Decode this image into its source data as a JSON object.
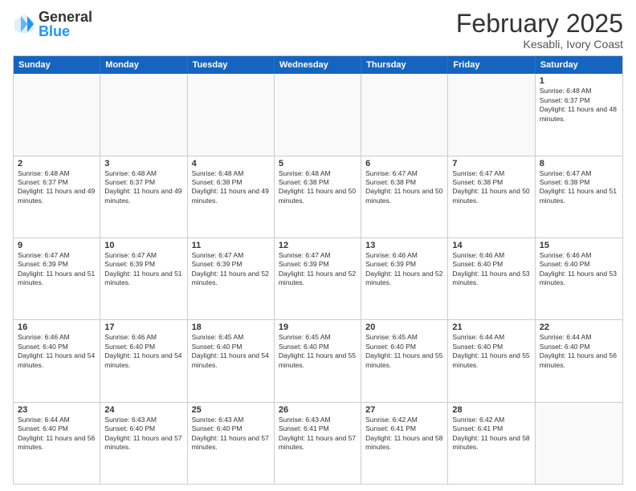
{
  "logo": {
    "general": "General",
    "blue": "Blue"
  },
  "title": {
    "month": "February 2025",
    "location": "Kesabli, Ivory Coast"
  },
  "header": {
    "days": [
      "Sunday",
      "Monday",
      "Tuesday",
      "Wednesday",
      "Thursday",
      "Friday",
      "Saturday"
    ]
  },
  "weeks": [
    [
      {
        "day": "",
        "text": ""
      },
      {
        "day": "",
        "text": ""
      },
      {
        "day": "",
        "text": ""
      },
      {
        "day": "",
        "text": ""
      },
      {
        "day": "",
        "text": ""
      },
      {
        "day": "",
        "text": ""
      },
      {
        "day": "1",
        "text": "Sunrise: 6:48 AM\nSunset: 6:37 PM\nDaylight: 11 hours and 48 minutes."
      }
    ],
    [
      {
        "day": "2",
        "text": "Sunrise: 6:48 AM\nSunset: 6:37 PM\nDaylight: 11 hours and 49 minutes."
      },
      {
        "day": "3",
        "text": "Sunrise: 6:48 AM\nSunset: 6:37 PM\nDaylight: 11 hours and 49 minutes."
      },
      {
        "day": "4",
        "text": "Sunrise: 6:48 AM\nSunset: 6:38 PM\nDaylight: 11 hours and 49 minutes."
      },
      {
        "day": "5",
        "text": "Sunrise: 6:48 AM\nSunset: 6:38 PM\nDaylight: 11 hours and 50 minutes."
      },
      {
        "day": "6",
        "text": "Sunrise: 6:47 AM\nSunset: 6:38 PM\nDaylight: 11 hours and 50 minutes."
      },
      {
        "day": "7",
        "text": "Sunrise: 6:47 AM\nSunset: 6:38 PM\nDaylight: 11 hours and 50 minutes."
      },
      {
        "day": "8",
        "text": "Sunrise: 6:47 AM\nSunset: 6:38 PM\nDaylight: 11 hours and 51 minutes."
      }
    ],
    [
      {
        "day": "9",
        "text": "Sunrise: 6:47 AM\nSunset: 6:39 PM\nDaylight: 11 hours and 51 minutes."
      },
      {
        "day": "10",
        "text": "Sunrise: 6:47 AM\nSunset: 6:39 PM\nDaylight: 11 hours and 51 minutes."
      },
      {
        "day": "11",
        "text": "Sunrise: 6:47 AM\nSunset: 6:39 PM\nDaylight: 11 hours and 52 minutes."
      },
      {
        "day": "12",
        "text": "Sunrise: 6:47 AM\nSunset: 6:39 PM\nDaylight: 11 hours and 52 minutes."
      },
      {
        "day": "13",
        "text": "Sunrise: 6:46 AM\nSunset: 6:39 PM\nDaylight: 11 hours and 52 minutes."
      },
      {
        "day": "14",
        "text": "Sunrise: 6:46 AM\nSunset: 6:40 PM\nDaylight: 11 hours and 53 minutes."
      },
      {
        "day": "15",
        "text": "Sunrise: 6:46 AM\nSunset: 6:40 PM\nDaylight: 11 hours and 53 minutes."
      }
    ],
    [
      {
        "day": "16",
        "text": "Sunrise: 6:46 AM\nSunset: 6:40 PM\nDaylight: 11 hours and 54 minutes."
      },
      {
        "day": "17",
        "text": "Sunrise: 6:46 AM\nSunset: 6:40 PM\nDaylight: 11 hours and 54 minutes."
      },
      {
        "day": "18",
        "text": "Sunrise: 6:45 AM\nSunset: 6:40 PM\nDaylight: 11 hours and 54 minutes."
      },
      {
        "day": "19",
        "text": "Sunrise: 6:45 AM\nSunset: 6:40 PM\nDaylight: 11 hours and 55 minutes."
      },
      {
        "day": "20",
        "text": "Sunrise: 6:45 AM\nSunset: 6:40 PM\nDaylight: 11 hours and 55 minutes."
      },
      {
        "day": "21",
        "text": "Sunrise: 6:44 AM\nSunset: 6:40 PM\nDaylight: 11 hours and 55 minutes."
      },
      {
        "day": "22",
        "text": "Sunrise: 6:44 AM\nSunset: 6:40 PM\nDaylight: 11 hours and 56 minutes."
      }
    ],
    [
      {
        "day": "23",
        "text": "Sunrise: 6:44 AM\nSunset: 6:40 PM\nDaylight: 11 hours and 56 minutes."
      },
      {
        "day": "24",
        "text": "Sunrise: 6:43 AM\nSunset: 6:40 PM\nDaylight: 11 hours and 57 minutes."
      },
      {
        "day": "25",
        "text": "Sunrise: 6:43 AM\nSunset: 6:40 PM\nDaylight: 11 hours and 57 minutes."
      },
      {
        "day": "26",
        "text": "Sunrise: 6:43 AM\nSunset: 6:41 PM\nDaylight: 11 hours and 57 minutes."
      },
      {
        "day": "27",
        "text": "Sunrise: 6:42 AM\nSunset: 6:41 PM\nDaylight: 11 hours and 58 minutes."
      },
      {
        "day": "28",
        "text": "Sunrise: 6:42 AM\nSunset: 6:41 PM\nDaylight: 11 hours and 58 minutes."
      },
      {
        "day": "",
        "text": ""
      }
    ]
  ]
}
